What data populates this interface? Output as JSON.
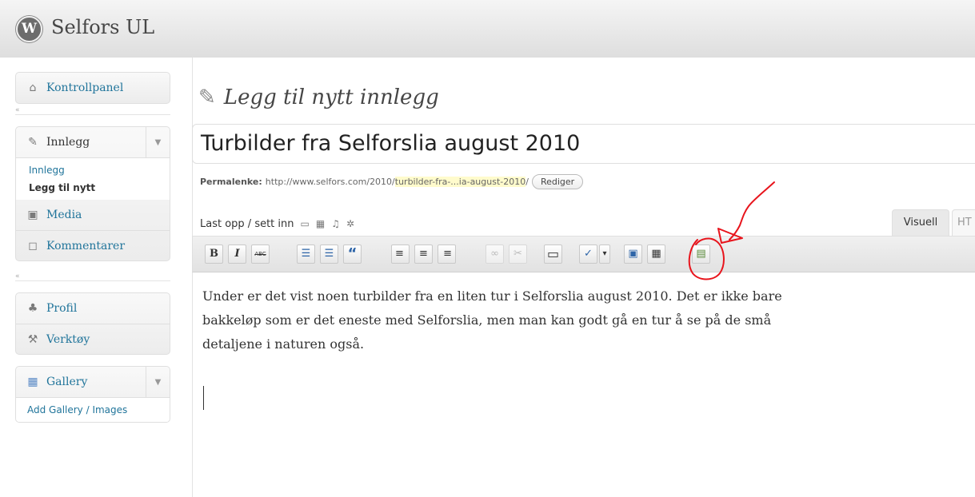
{
  "header": {
    "site_title": "Selfors UL",
    "logo_letter": "W"
  },
  "sidebar": {
    "dashboard": {
      "label": "Kontrollpanel",
      "icon": "house-icon"
    },
    "posts": {
      "label": "Innlegg",
      "icon": "pushpin-icon",
      "submenu": [
        {
          "label": "Innlegg"
        },
        {
          "label": "Legg til nytt",
          "current": true
        }
      ]
    },
    "media": {
      "label": "Media",
      "icon": "camera-icon"
    },
    "comments": {
      "label": "Kommentarer",
      "icon": "speech-bubble-icon"
    },
    "profile": {
      "label": "Profil",
      "icon": "users-icon"
    },
    "tools": {
      "label": "Verktøy",
      "icon": "tools-icon"
    },
    "gallery": {
      "label": "Gallery",
      "icon": "gallery-icon",
      "submenu": [
        {
          "label": "Add Gallery / Images"
        }
      ]
    },
    "collapse_glyph": "«",
    "toggle_glyph": "▼"
  },
  "main": {
    "page_title": "Legg til nytt innlegg",
    "post_title": "Turbilder fra Selforslia august 2010",
    "permalink": {
      "label": "Permalenke:",
      "base": "http://www.selfors.com/2010/",
      "slug": "turbilder-fra-...ia-august-2010",
      "suffix": "/",
      "edit_button": "Rediger"
    },
    "upload_label": "Last opp / sett inn",
    "upload_icons": [
      "image-icon",
      "video-icon",
      "audio-icon",
      "media-icon"
    ],
    "tabs": {
      "visual": "Visuell",
      "html": "HT"
    },
    "toolbar": [
      {
        "name": "bold-button",
        "glyph": "B"
      },
      {
        "name": "italic-button",
        "glyph": "I"
      },
      {
        "name": "strikethrough-button",
        "glyph": "ABC"
      },
      {
        "name": "bulleted-list-button",
        "glyph": "☰"
      },
      {
        "name": "numbered-list-button",
        "glyph": "☰"
      },
      {
        "name": "blockquote-button",
        "glyph": "“"
      },
      {
        "name": "align-left-button",
        "glyph": "≡"
      },
      {
        "name": "align-center-button",
        "glyph": "≡"
      },
      {
        "name": "align-right-button",
        "glyph": "≡"
      },
      {
        "name": "insert-link-button",
        "glyph": "∞"
      },
      {
        "name": "unlink-button",
        "glyph": "✂"
      },
      {
        "name": "insert-more-button",
        "glyph": "▭"
      },
      {
        "name": "spellcheck-button",
        "glyph": "✓"
      },
      {
        "name": "spellcheck-dropdown-button",
        "glyph": "▾"
      },
      {
        "name": "fullscreen-button",
        "glyph": "▣"
      },
      {
        "name": "kitchen-sink-button",
        "glyph": "▦"
      },
      {
        "name": "gallery-insert-button",
        "glyph": "▤"
      }
    ],
    "content": [
      "Under er det vist noen turbilder fra en liten tur i Selforslia august 2010. Det er ikke bare",
      "bakkeløp som er det eneste med Selforslia, men man kan godt gå en tur å se på de små",
      "detaljene i naturen også."
    ]
  },
  "annotation_color": "#e8141c"
}
